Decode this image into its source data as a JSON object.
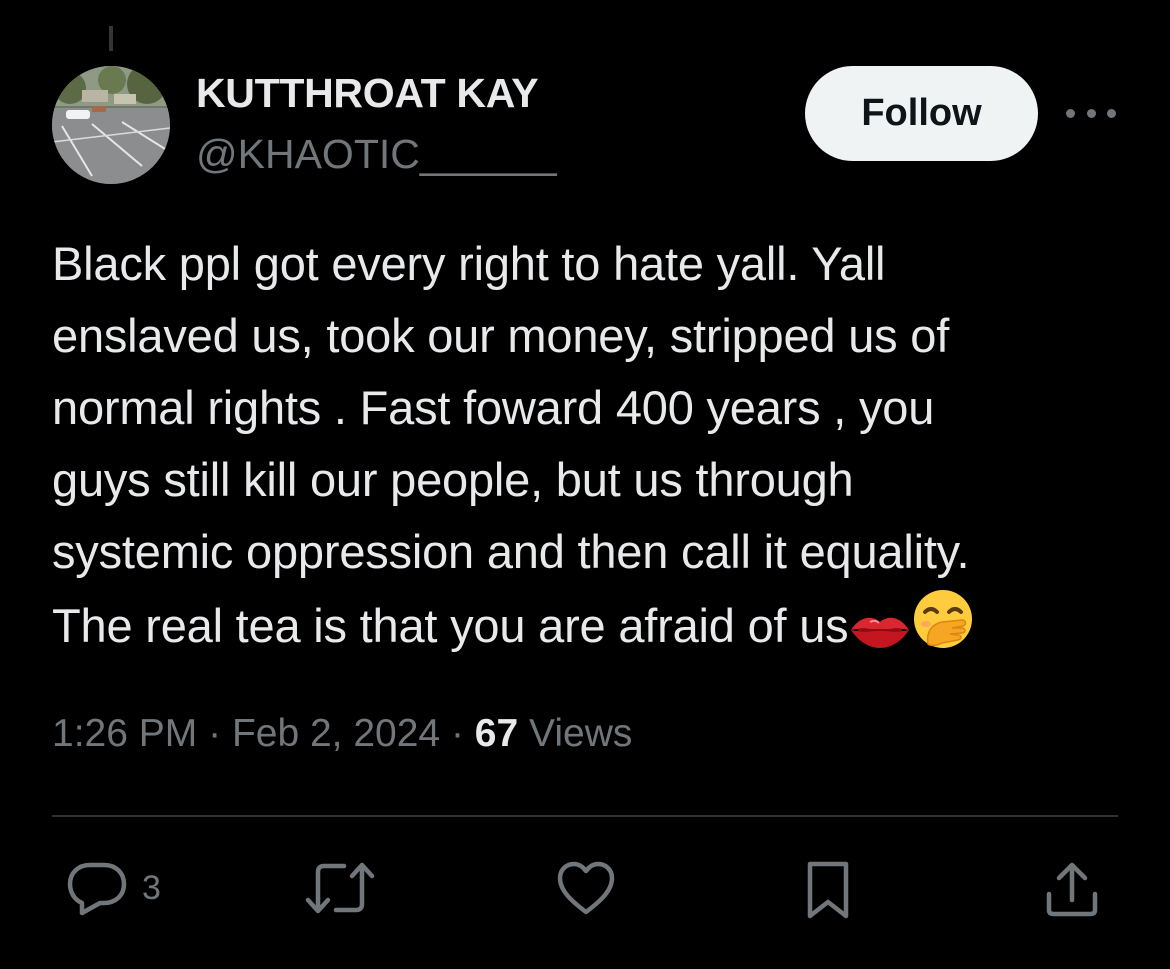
{
  "author": {
    "display_name": "KUTTHROAT KAY",
    "handle": "@KHAOTIC______"
  },
  "follow_label": "Follow",
  "tweet": {
    "text": "Black ppl got every right to hate yall. Yall\nenslaved us, took our money, stripped us of\nnormal rights . Fast foward 400 years , you\nguys still kill our people, but us through\nsystemic oppression and then call it equality.\nThe real tea is that you are afraid of us",
    "emojis": [
      "kiss-mark-emoji",
      "face-with-hand-over-mouth-emoji"
    ]
  },
  "meta": {
    "time": "1:26 PM",
    "separator": "·",
    "date": "Feb 2, 2024",
    "views_count": "67",
    "views_label": "Views"
  },
  "actions": {
    "reply_count": "3",
    "icons": [
      "reply-icon",
      "retweet-icon",
      "like-icon",
      "bookmark-icon",
      "share-icon"
    ]
  },
  "colors": {
    "background": "#000000",
    "primary_text": "#e7e9ea",
    "secondary_text": "#71767b",
    "follow_button_bg": "#eff3f4",
    "follow_button_text": "#0f1419",
    "divider": "#2f3336"
  }
}
